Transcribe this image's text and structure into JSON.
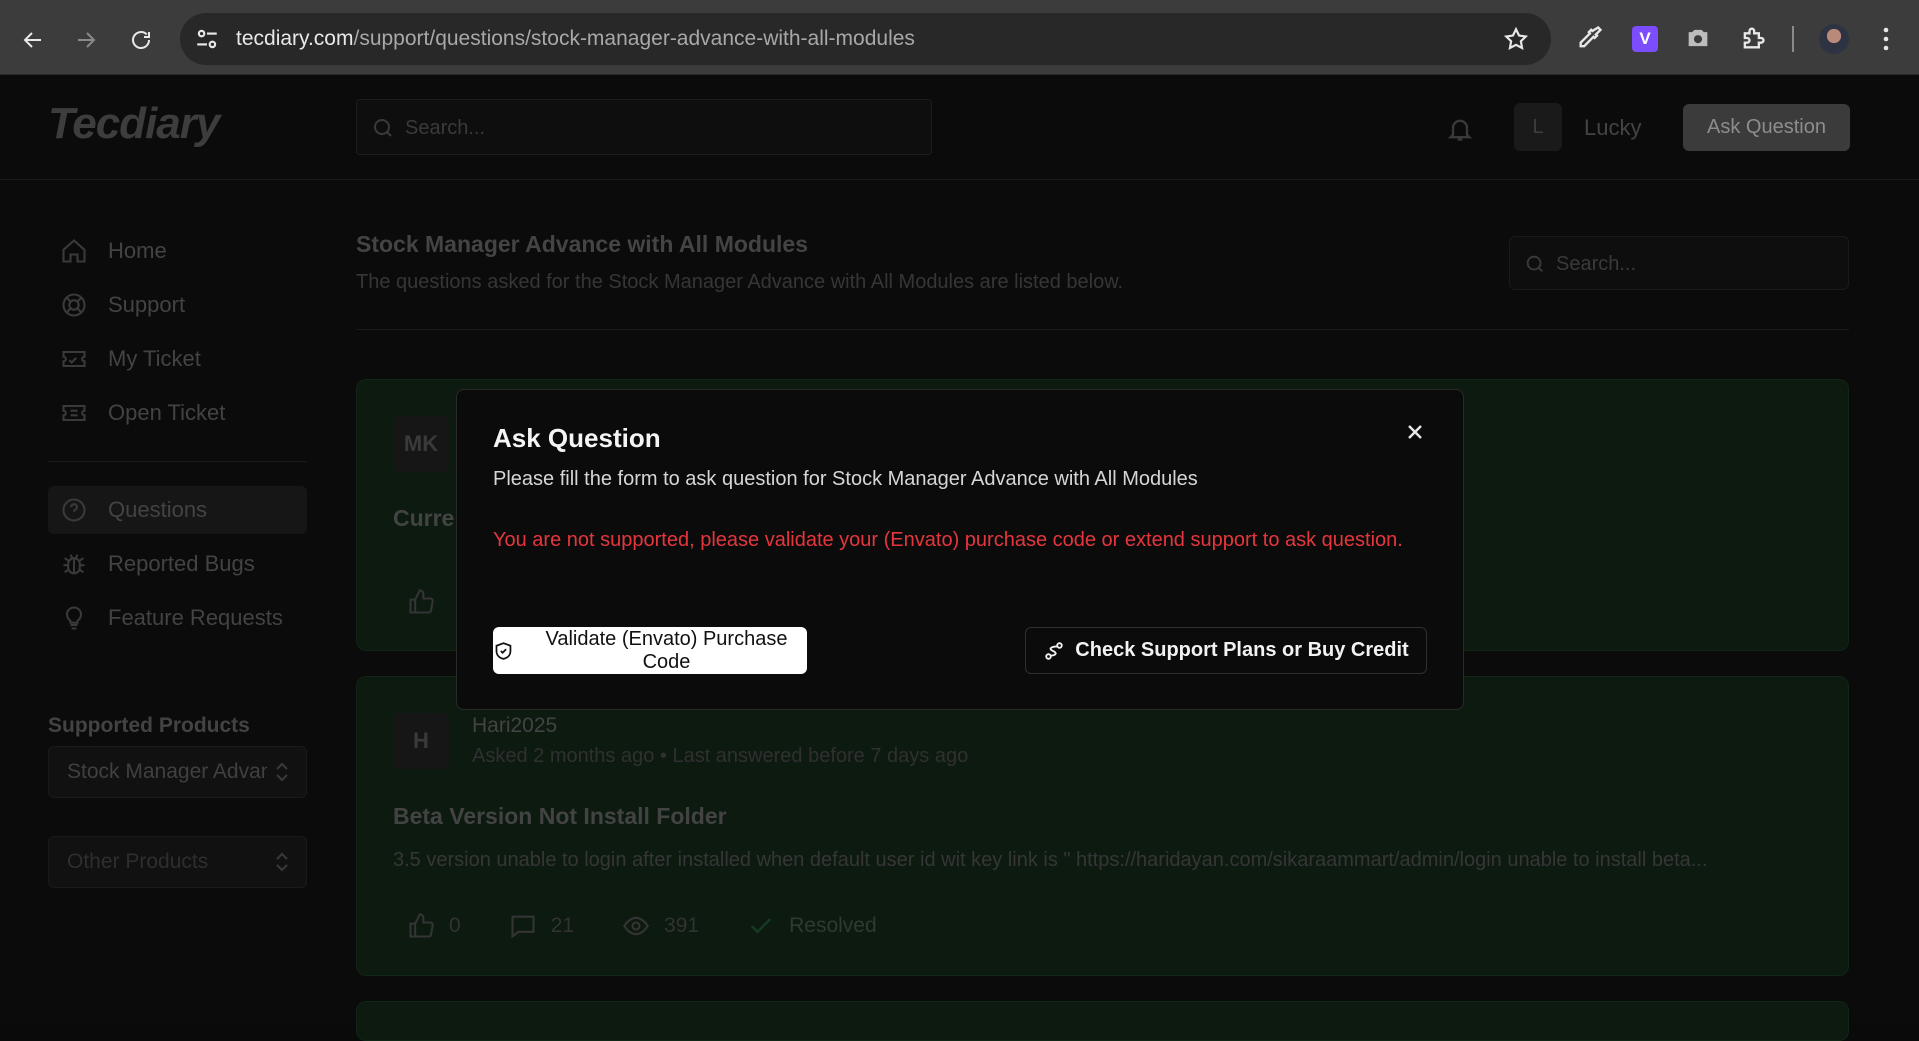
{
  "browser": {
    "url_domain": "tecdiary.com",
    "url_path": "/support/questions/stock-manager-advance-with-all-modules",
    "extension_v_label": "V"
  },
  "header": {
    "logo": "Tecdiary",
    "search_placeholder": "Search...",
    "avatar_initial": "L",
    "user_name": "Lucky",
    "ask_button": "Ask Question"
  },
  "sidebar": {
    "items": [
      {
        "label": "Home",
        "icon": "home-icon"
      },
      {
        "label": "Support",
        "icon": "lifebuoy-icon"
      },
      {
        "label": "My Ticket",
        "icon": "ticket-icon"
      },
      {
        "label": "Open Ticket",
        "icon": "ticket-icon"
      },
      {
        "label": "Questions",
        "icon": "question-circle-icon",
        "active": true
      },
      {
        "label": "Reported Bugs",
        "icon": "bug-icon"
      },
      {
        "label": "Feature Requests",
        "icon": "lightbulb-icon"
      }
    ],
    "supported_heading": "Supported Products",
    "supported_select": "Stock Manager Advance with All Modules",
    "other_select": "Other Products"
  },
  "main": {
    "title": "Stock Manager Advance with All Modules",
    "subtitle": "The questions asked for the Stock Manager Advance with All Modules are listed below.",
    "search_placeholder": "Search...",
    "cards": [
      {
        "initials": "MK",
        "title": "Curre"
      },
      {
        "initials": "H",
        "author": "Hari2025",
        "meta": "Asked 2 months ago • Last answered before 7 days ago",
        "title": "Beta Version Not Install Folder",
        "excerpt": "3.5 version unable to login after installed when default user id wit key link is \" https://haridayan.com/sikaraammart/admin/login unable to install beta...",
        "likes": "0",
        "comments": "21",
        "views": "391",
        "status": "Resolved"
      }
    ]
  },
  "modal": {
    "title": "Ask Question",
    "description": "Please fill the form to ask question for Stock Manager Advance with All Modules",
    "error": "You are not supported, please validate your (Envato) purchase code or extend support to ask question.",
    "validate_button": "Validate (Envato) Purchase Code",
    "plans_button": "Check Support Plans or Buy Credit"
  },
  "colors": {
    "error": "#e5363d",
    "card_bg": "#0c1a10",
    "extension_v": "#7c4dff"
  }
}
